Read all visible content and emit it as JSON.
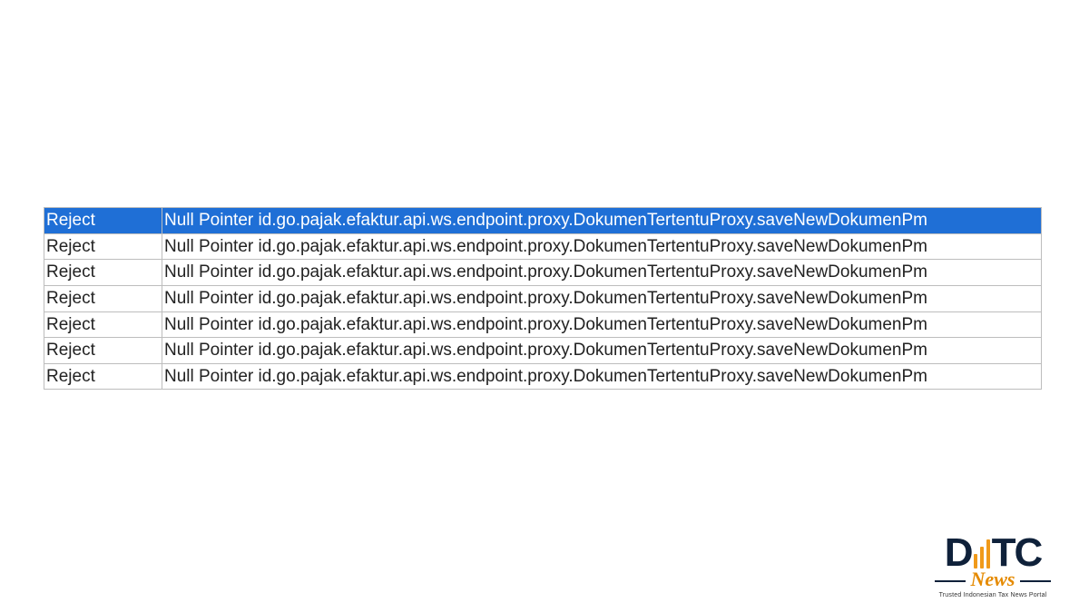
{
  "table": {
    "rows": [
      {
        "status": "Reject",
        "message": "Null Pointer id.go.pajak.efaktur.api.ws.endpoint.proxy.DokumenTertentuProxy.saveNewDokumenPm",
        "selected": true
      },
      {
        "status": "Reject",
        "message": "Null Pointer id.go.pajak.efaktur.api.ws.endpoint.proxy.DokumenTertentuProxy.saveNewDokumenPm",
        "selected": false
      },
      {
        "status": "Reject",
        "message": "Null Pointer id.go.pajak.efaktur.api.ws.endpoint.proxy.DokumenTertentuProxy.saveNewDokumenPm",
        "selected": false
      },
      {
        "status": "Reject",
        "message": "Null Pointer id.go.pajak.efaktur.api.ws.endpoint.proxy.DokumenTertentuProxy.saveNewDokumenPm",
        "selected": false
      },
      {
        "status": "Reject",
        "message": "Null Pointer id.go.pajak.efaktur.api.ws.endpoint.proxy.DokumenTertentuProxy.saveNewDokumenPm",
        "selected": false
      },
      {
        "status": "Reject",
        "message": "Null Pointer id.go.pajak.efaktur.api.ws.endpoint.proxy.DokumenTertentuProxy.saveNewDokumenPm",
        "selected": false
      },
      {
        "status": "Reject",
        "message": "Null Pointer id.go.pajak.efaktur.api.ws.endpoint.proxy.DokumenTertentuProxy.saveNewDokumenPm",
        "selected": false
      }
    ]
  },
  "logo": {
    "brand_left": "D",
    "brand_right": "TC",
    "news": "News",
    "tagline": "Trusted Indonesian Tax News Portal"
  }
}
